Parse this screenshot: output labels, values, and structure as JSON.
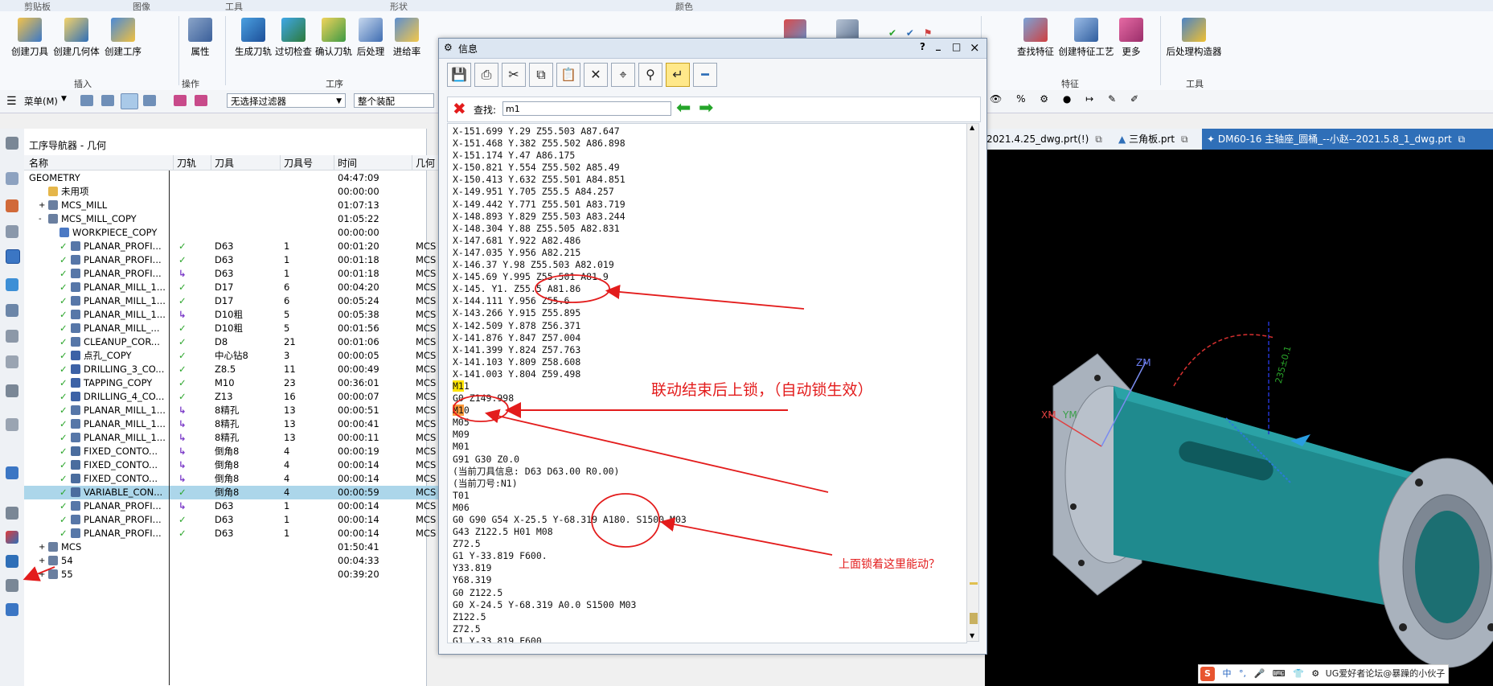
{
  "ribbon_group_titles": [
    "剪贴板",
    "图像",
    "工具",
    "形状",
    "颜色"
  ],
  "ribbon": {
    "buttons": [
      {
        "label": "创建刀具",
        "icon": "create-tool-icon"
      },
      {
        "label": "创建几何体",
        "icon": "create-geometry-icon"
      },
      {
        "label": "创建工序",
        "icon": "create-operation-icon"
      },
      {
        "label": "属性",
        "icon": "properties-icon"
      },
      {
        "label": "生成刀轨",
        "icon": "generate-toolpath-icon"
      },
      {
        "label": "过切检查",
        "icon": "gouge-check-icon"
      },
      {
        "label": "确认刀轨",
        "icon": "verify-toolpath-icon"
      },
      {
        "label": "后处理",
        "icon": "postprocess-icon"
      },
      {
        "label": "进给率",
        "icon": "feedrate-icon"
      },
      {
        "label": "查找特征",
        "icon": "find-feature-icon"
      },
      {
        "label": "创建特征工艺",
        "icon": "feature-process-icon"
      },
      {
        "label": "更多",
        "icon": "more-icon"
      },
      {
        "label": "后处理构造器",
        "icon": "post-builder-icon"
      }
    ],
    "group_labels": [
      "插入",
      "操作",
      "工序",
      "特征",
      "工具"
    ]
  },
  "toolbar2": {
    "menu_label": "菜单(M)",
    "filter_value": "无选择过滤器",
    "assembly_value": "整个装配"
  },
  "navigator": {
    "title": "工序导航器 - 几何",
    "columns": [
      "名称",
      "刀轨",
      "刀具",
      "刀具号",
      "时间",
      "几何"
    ],
    "rows": [
      {
        "name": "GEOMETRY",
        "path": "",
        "tool": "",
        "num": "",
        "time": "04:47:09",
        "geo": "",
        "level": 0,
        "tog": "",
        "icon": ""
      },
      {
        "name": "未用项",
        "path": "",
        "tool": "",
        "num": "",
        "time": "00:00:00",
        "geo": "",
        "level": 1,
        "tog": "",
        "icon": "folder"
      },
      {
        "name": "MCS_MILL",
        "path": "",
        "tool": "",
        "num": "",
        "time": "01:07:13",
        "geo": "",
        "level": 1,
        "tog": "+",
        "icon": "mcs"
      },
      {
        "name": "MCS_MILL_COPY",
        "path": "",
        "tool": "",
        "num": "",
        "time": "01:05:22",
        "geo": "",
        "level": 1,
        "tog": "-",
        "icon": "mcs"
      },
      {
        "name": "WORKPIECE_COPY",
        "path": "",
        "tool": "",
        "num": "",
        "time": "00:00:00",
        "geo": "",
        "level": 2,
        "tog": "",
        "icon": "workpiece"
      },
      {
        "name": "PLANAR_PROFI...",
        "path": "✓",
        "tool": "D63",
        "num": "1",
        "time": "00:01:20",
        "geo": "MCS",
        "level": 2,
        "tog": "",
        "icon": "op"
      },
      {
        "name": "PLANAR_PROFI...",
        "path": "✓",
        "tool": "D63",
        "num": "1",
        "time": "00:01:18",
        "geo": "MCS",
        "level": 2,
        "tog": "",
        "icon": "op"
      },
      {
        "name": "PLANAR_PROFI...",
        "path": "↳",
        "tool": "D63",
        "num": "1",
        "time": "00:01:18",
        "geo": "MCS",
        "level": 2,
        "tog": "",
        "icon": "op"
      },
      {
        "name": "PLANAR_MILL_1...",
        "path": "✓",
        "tool": "D17",
        "num": "6",
        "time": "00:04:20",
        "geo": "MCS",
        "level": 2,
        "tog": "",
        "icon": "op"
      },
      {
        "name": "PLANAR_MILL_1...",
        "path": "✓",
        "tool": "D17",
        "num": "6",
        "time": "00:05:24",
        "geo": "MCS",
        "level": 2,
        "tog": "",
        "icon": "op"
      },
      {
        "name": "PLANAR_MILL_1...",
        "path": "↳",
        "tool": "D10粗",
        "num": "5",
        "time": "00:05:38",
        "geo": "MCS",
        "level": 2,
        "tog": "",
        "icon": "op"
      },
      {
        "name": "PLANAR_MILL_...",
        "path": "✓",
        "tool": "D10粗",
        "num": "5",
        "time": "00:01:56",
        "geo": "MCS",
        "level": 2,
        "tog": "",
        "icon": "op"
      },
      {
        "name": "CLEANUP_COR...",
        "path": "✓",
        "tool": "D8",
        "num": "21",
        "time": "00:01:06",
        "geo": "MCS",
        "level": 2,
        "tog": "",
        "icon": "op"
      },
      {
        "name": "点孔_COPY",
        "path": "✓",
        "tool": "中心钻8",
        "num": "3",
        "time": "00:00:05",
        "geo": "MCS",
        "level": 2,
        "tog": "",
        "icon": "drill"
      },
      {
        "name": "DRILLING_3_CO...",
        "path": "✓",
        "tool": "Z8.5",
        "num": "11",
        "time": "00:00:49",
        "geo": "MCS",
        "level": 2,
        "tog": "",
        "icon": "drill"
      },
      {
        "name": "TAPPING_COPY",
        "path": "✓",
        "tool": "M10",
        "num": "23",
        "time": "00:36:01",
        "geo": "MCS",
        "level": 2,
        "tog": "",
        "icon": "drill"
      },
      {
        "name": "DRILLING_4_CO...",
        "path": "✓",
        "tool": "Z13",
        "num": "16",
        "time": "00:00:07",
        "geo": "MCS",
        "level": 2,
        "tog": "",
        "icon": "drill"
      },
      {
        "name": "PLANAR_MILL_1...",
        "path": "↳",
        "tool": "8精孔",
        "num": "13",
        "time": "00:00:51",
        "geo": "MCS",
        "level": 2,
        "tog": "",
        "icon": "op"
      },
      {
        "name": "PLANAR_MILL_1...",
        "path": "↳",
        "tool": "8精孔",
        "num": "13",
        "time": "00:00:41",
        "geo": "MCS",
        "level": 2,
        "tog": "",
        "icon": "op"
      },
      {
        "name": "PLANAR_MILL_1...",
        "path": "↳",
        "tool": "8精孔",
        "num": "13",
        "time": "00:00:11",
        "geo": "MCS",
        "level": 2,
        "tog": "",
        "icon": "op"
      },
      {
        "name": "FIXED_CONTO...",
        "path": "↳",
        "tool": "倒角8",
        "num": "4",
        "time": "00:00:19",
        "geo": "MCS",
        "level": 2,
        "tog": "",
        "icon": "contour"
      },
      {
        "name": "FIXED_CONTO...",
        "path": "↳",
        "tool": "倒角8",
        "num": "4",
        "time": "00:00:14",
        "geo": "MCS",
        "level": 2,
        "tog": "",
        "icon": "contour"
      },
      {
        "name": "FIXED_CONTO...",
        "path": "↳",
        "tool": "倒角8",
        "num": "4",
        "time": "00:00:14",
        "geo": "MCS",
        "level": 2,
        "tog": "",
        "icon": "contour"
      },
      {
        "name": "VARIABLE_CON...",
        "path": "✓",
        "tool": "倒角8",
        "num": "4",
        "time": "00:00:59",
        "geo": "MCS",
        "level": 2,
        "tog": "",
        "icon": "contour",
        "selected": true
      },
      {
        "name": "PLANAR_PROFI...",
        "path": "↳",
        "tool": "D63",
        "num": "1",
        "time": "00:00:14",
        "geo": "MCS",
        "level": 2,
        "tog": "",
        "icon": "op"
      },
      {
        "name": "PLANAR_PROFI...",
        "path": "✓",
        "tool": "D63",
        "num": "1",
        "time": "00:00:14",
        "geo": "MCS",
        "level": 2,
        "tog": "",
        "icon": "op"
      },
      {
        "name": "PLANAR_PROFI...",
        "path": "✓",
        "tool": "D63",
        "num": "1",
        "time": "00:00:14",
        "geo": "MCS",
        "level": 2,
        "tog": "",
        "icon": "op"
      },
      {
        "name": "MCS",
        "path": "",
        "tool": "",
        "num": "",
        "time": "01:50:41",
        "geo": "",
        "level": 1,
        "tog": "+",
        "icon": "mcs"
      },
      {
        "name": "54",
        "path": "",
        "tool": "",
        "num": "",
        "time": "00:04:33",
        "geo": "",
        "level": 1,
        "tog": "+",
        "icon": "mcs"
      },
      {
        "name": "55",
        "path": "",
        "tool": "",
        "num": "",
        "time": "00:39:20",
        "geo": "",
        "level": 1,
        "tog": "+",
        "icon": "mcs"
      }
    ]
  },
  "graphics_tabs": [
    {
      "label": "2021.4.25_dwg.prt(!)"
    },
    {
      "label": "三角板.prt"
    },
    {
      "label": "DM60-16 主轴座_圆桶_--小赵--2021.5.8_1_dwg.prt"
    }
  ],
  "viewport": {
    "xm_label": "XM",
    "ym_label": "YM",
    "zm_label": "ZM",
    "dim_label": "235±0.1"
  },
  "dialog": {
    "title": "信息",
    "title_buttons": [
      "?",
      "_",
      "□",
      "×"
    ],
    "find_label": "查找:",
    "find_value": "m1",
    "code_lines": [
      "X-151.699 Y.29 Z55.503 A87.647",
      "X-151.468 Y.382 Z55.502 A86.898",
      "X-151.174 Y.47 A86.175",
      "X-150.821 Y.554 Z55.502 A85.49",
      "X-150.413 Y.632 Z55.501 A84.851",
      "X-149.951 Y.705 Z55.5 A84.257",
      "X-149.442 Y.771 Z55.501 A83.719",
      "X-148.893 Y.829 Z55.503 A83.244",
      "X-148.304 Y.88 Z55.505 A82.831",
      "X-147.681 Y.922 A82.486",
      "X-147.035 Y.956 A82.215",
      "X-146.37 Y.98 Z55.503 A82.019",
      "X-145.69 Y.995 Z55.501 A81.9",
      "X-145. Y1. Z55.5 A81.86",
      "X-144.111 Y.956 Z55.6",
      "X-143.266 Y.915 Z55.895",
      "X-142.509 Y.878 Z56.371",
      "X-141.876 Y.847 Z57.004",
      "X-141.399 Y.824 Z57.763",
      "X-141.103 Y.809 Z58.608",
      "X-141.003 Y.804 Z59.498",
      "M11",
      "G0 Z149.998",
      "M10",
      "M05",
      "M09",
      "M01",
      "G91 G30 Z0.0",
      "(当前刀具信息: D63 D63.00 R0.00)",
      "(当前刀号:N1)",
      "T01",
      "M06",
      "G0 G90 G54 X-25.5 Y-68.319 A180. S1500 M03",
      "G43 Z122.5 H01 M08",
      "Z72.5",
      "G1 Y-33.819 F600.",
      "Y33.819",
      "Y68.319",
      "G0 Z122.5",
      "G0 X-24.5 Y-68.319 A0.0 S1500 M03",
      "Z122.5",
      "Z72.5",
      "G1 Y-33.819 F600."
    ]
  },
  "annotations": {
    "lock_note": "联动结束后上锁，（自动锁生效）",
    "question_note": "上面锁着这里能动？"
  },
  "ime_bar": {
    "items": [
      "中",
      "°,",
      "🎤",
      "⌨",
      "👕",
      "⚙"
    ],
    "watermark": "UG爱好者论坛@暴躁的小伙子"
  },
  "colors": {
    "accent_red": "#e31c1c",
    "check_green": "#2aa52a",
    "selected_row": "#acd6ea",
    "highlight_yellow": "#ffe400",
    "highlight_orange": "#ff9a3a",
    "part_teal": "#1f8a8e"
  }
}
